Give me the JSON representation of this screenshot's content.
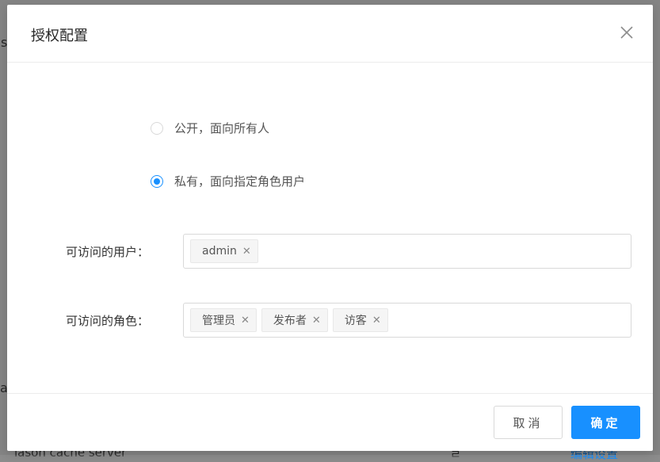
{
  "background": {
    "fragments": [
      "s",
      "a",
      "lason cacne server",
      "ㄹ",
      "编辑设置"
    ]
  },
  "modal": {
    "title": "授权配置",
    "close_icon": "close-icon",
    "visibility_options": [
      {
        "label": "公开，面向所有人",
        "checked": false
      },
      {
        "label": "私有，面向指定角色用户",
        "checked": true
      }
    ],
    "users_field": {
      "label": "可访问的用户：",
      "tags": [
        "admin"
      ]
    },
    "roles_field": {
      "label": "可访问的角色：",
      "tags": [
        "管理员",
        "发布者",
        "访客"
      ]
    },
    "footer": {
      "cancel_label": "取消",
      "ok_label": "确定"
    }
  },
  "colors": {
    "primary": "#1890ff",
    "border": "#d9d9d9",
    "tag_bg": "#f5f5f5"
  }
}
